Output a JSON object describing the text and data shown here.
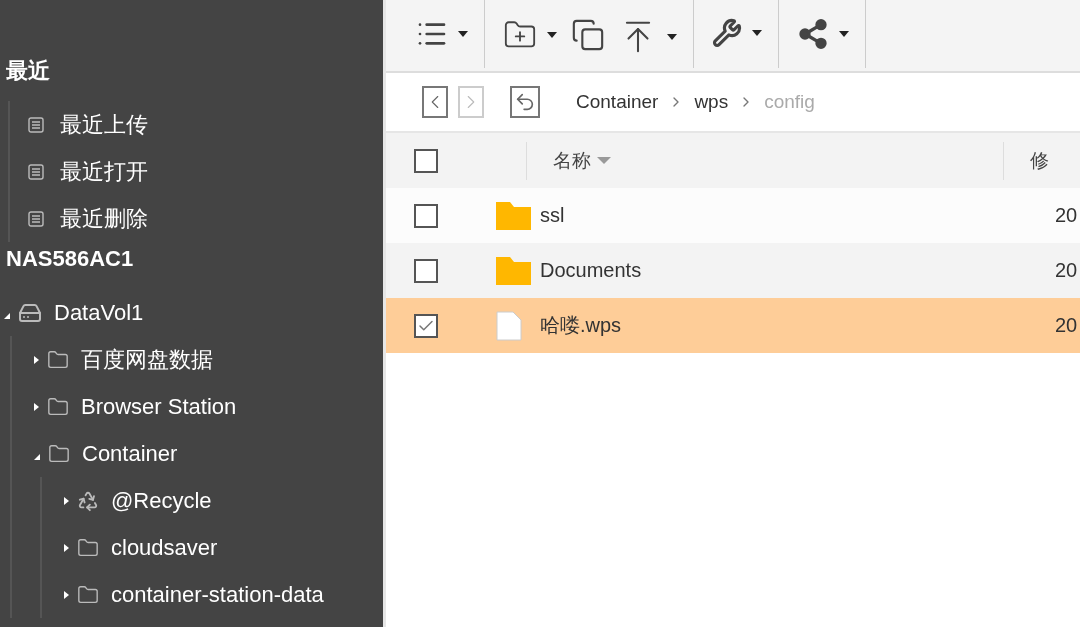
{
  "sidebar": {
    "sections": [
      {
        "title": "最近",
        "items": [
          {
            "label": "最近上传"
          },
          {
            "label": "最近打开"
          },
          {
            "label": "最近删除"
          }
        ]
      },
      {
        "title": "NAS586AC1",
        "tree": [
          {
            "label": "DataVol1",
            "kind": "drive",
            "expanded": true,
            "children": [
              {
                "label": "百度网盘数据",
                "kind": "folder",
                "expanded": false
              },
              {
                "label": "Browser Station",
                "kind": "folder",
                "expanded": false
              },
              {
                "label": "Container",
                "kind": "folder",
                "expanded": true,
                "children": [
                  {
                    "label": "@Recycle",
                    "kind": "recycle",
                    "expanded": false
                  },
                  {
                    "label": "cloudsaver",
                    "kind": "folder",
                    "expanded": false
                  },
                  {
                    "label": "container-station-data",
                    "kind": "folder",
                    "expanded": false
                  }
                ]
              }
            ]
          }
        ]
      }
    ]
  },
  "toolbar": {
    "groups": [
      [
        {
          "kind": "list",
          "dropdown": true
        }
      ],
      [
        {
          "kind": "new-folder",
          "dropdown": true
        },
        {
          "kind": "copy",
          "dropdown": false
        },
        {
          "kind": "upload",
          "dropdown": true
        }
      ],
      [
        {
          "kind": "tools",
          "dropdown": true
        }
      ],
      [
        {
          "kind": "share",
          "dropdown": true
        }
      ]
    ]
  },
  "navigation": {
    "back_disabled": false,
    "forward_disabled": true,
    "path": [
      {
        "label": "Container",
        "current": false
      },
      {
        "label": "wps",
        "current": false
      },
      {
        "label": "config",
        "current": true
      }
    ]
  },
  "table": {
    "header_checked": false,
    "columns": [
      {
        "label": "名称",
        "sorted": true
      },
      {
        "label": "修"
      }
    ],
    "rows": [
      {
        "kind": "folder",
        "name": "ssl",
        "date": "20",
        "checked": false,
        "selected": false
      },
      {
        "kind": "folder",
        "name": "Documents",
        "date": "20",
        "checked": false,
        "selected": false
      },
      {
        "kind": "file",
        "name": "哈喽.wps",
        "date": "20",
        "checked": true,
        "selected": true
      }
    ]
  }
}
